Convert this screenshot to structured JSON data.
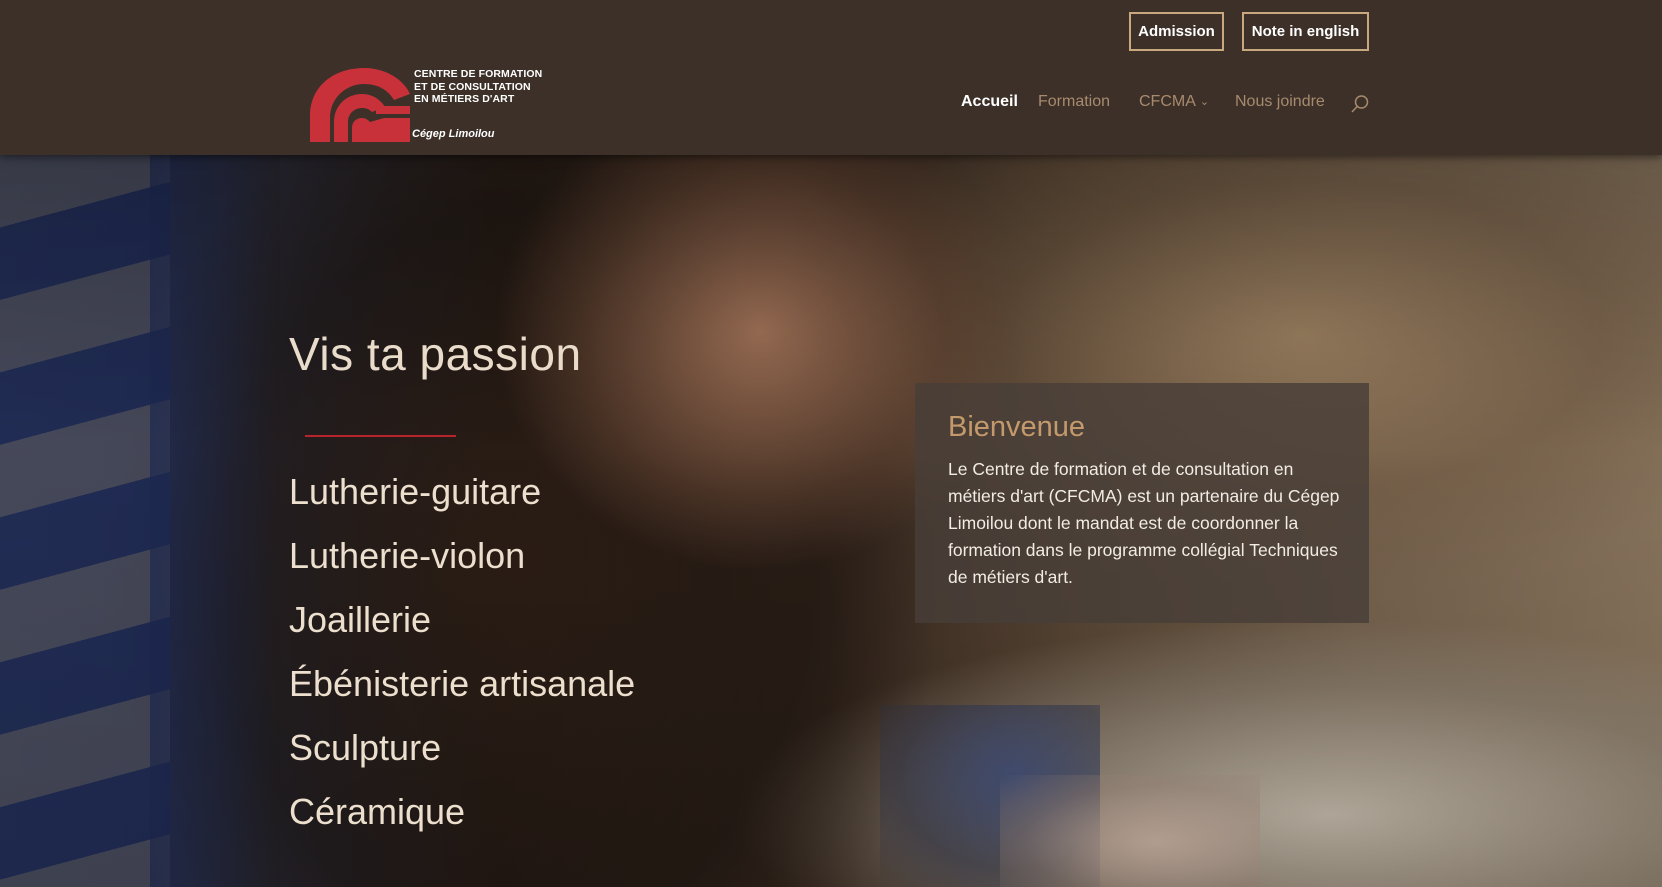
{
  "header": {
    "top_buttons": {
      "admission": "Admission",
      "english": "Note in english"
    },
    "logo": {
      "lines": [
        "CENTRE DE FORMATION",
        "ET DE CONSULTATION",
        "EN MÉTIERS D'ART"
      ],
      "subtitle": "Cégep Limoilou"
    },
    "nav": {
      "items": [
        {
          "label": "Accueil",
          "active": true
        },
        {
          "label": "Formation",
          "active": false
        },
        {
          "label": "CFCMA",
          "active": false,
          "has_dropdown": true
        },
        {
          "label": "Nous joindre",
          "active": false
        }
      ],
      "search_icon": "search-icon"
    }
  },
  "hero": {
    "title": "Vis ta passion",
    "programs": [
      "Lutherie-guitare",
      "Lutherie-violon",
      "Joaillerie",
      "Ébénisterie artisanale",
      "Sculpture",
      "Céramique"
    ],
    "welcome": {
      "title": "Bienvenue",
      "text": "Le Centre de formation et de consultation en métiers d'art (CFCMA) est un partenaire du Cégep Limoilou dont le mandat est de coordonner la formation dans le programme collégial Techniques de métiers d'art."
    }
  },
  "colors": {
    "header_bg": "#3c3028",
    "accent_gold": "#c49a6c",
    "nav_inactive": "#a88b6e",
    "divider_red": "#b5242b",
    "logo_red": "#c8313a"
  }
}
